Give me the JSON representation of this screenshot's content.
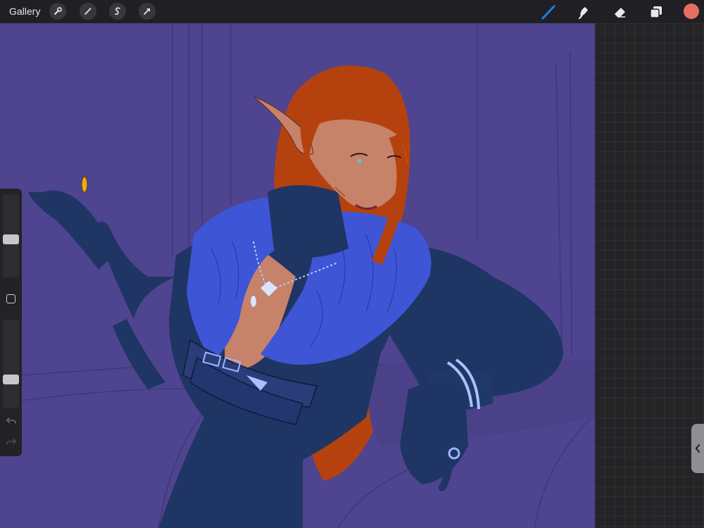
{
  "toolbar": {
    "gallery_label": "Gallery",
    "left_tools": [
      "wrench-icon",
      "magic-wand-icon",
      "selection-icon",
      "transform-arrow-icon"
    ],
    "right_tools": [
      "brush-icon",
      "smudge-icon",
      "eraser-icon",
      "layers-icon"
    ],
    "active_tool": "brush",
    "active_color": "#e57060",
    "accent_color": "#1e7cf2"
  },
  "sidebar": {
    "brush_size_level": 0.45,
    "opacity_level": 0.3
  },
  "canvas": {
    "background_color": "#4e4490",
    "artwork": "elf-portrait-sketch"
  }
}
